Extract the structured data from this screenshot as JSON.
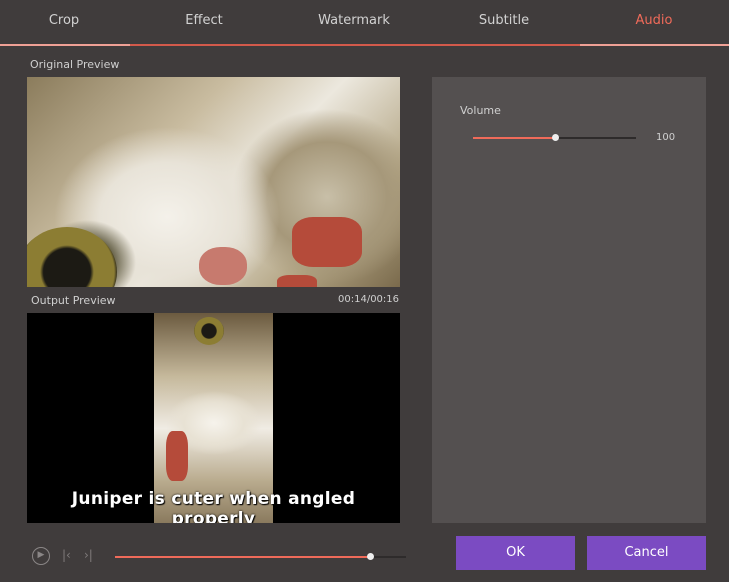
{
  "tabs": [
    {
      "label": "Crop"
    },
    {
      "label": "Effect"
    },
    {
      "label": "Watermark"
    },
    {
      "label": "Subtitle"
    },
    {
      "label": "Audio"
    }
  ],
  "active_tab": "Audio",
  "original_preview": {
    "label": "Original Preview"
  },
  "output_preview": {
    "label": "Output Preview",
    "timecode": "00:14/00:16",
    "subtitle_text": "Juniper is cuter when angled properly"
  },
  "audio": {
    "volume_label": "Volume",
    "volume_value": "100",
    "volume_fraction": 0.5
  },
  "playback": {
    "progress_fraction": 0.875,
    "icons": [
      "play-icon",
      "previous-frame-icon",
      "next-frame-icon"
    ]
  },
  "buttons": {
    "ok": "OK",
    "cancel": "Cancel"
  },
  "colors": {
    "accent": "#f06b5a",
    "button": "#7b4bc2",
    "background": "#403c3c",
    "panel": "#545050"
  }
}
